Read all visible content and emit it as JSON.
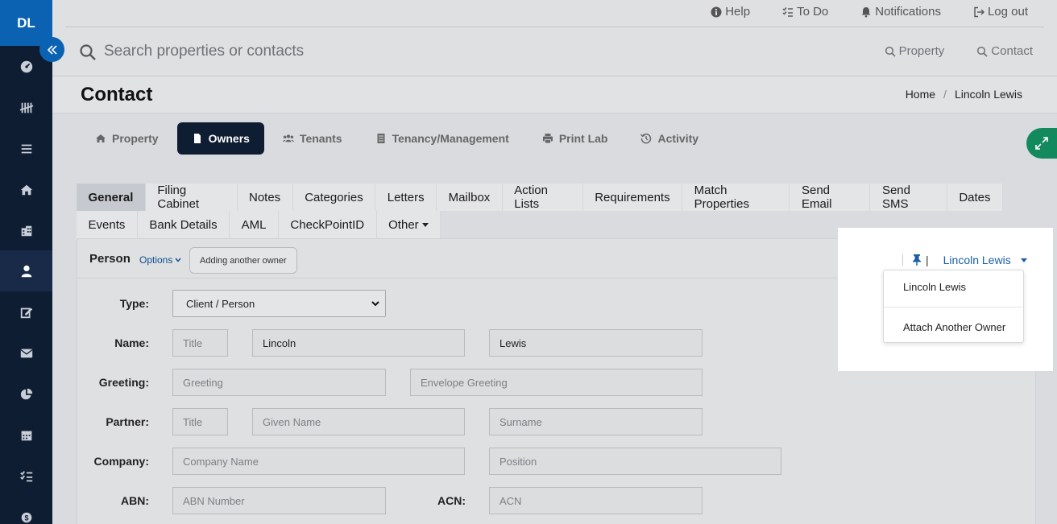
{
  "sidebar": {
    "brand": "DL",
    "items": [
      {
        "icon": "dashboard-icon"
      },
      {
        "icon": "tally-icon"
      },
      {
        "icon": "list-icon"
      },
      {
        "icon": "home-icon"
      },
      {
        "icon": "building-icon"
      },
      {
        "icon": "person-icon",
        "active": true
      },
      {
        "icon": "edit-icon"
      },
      {
        "icon": "mail-icon"
      },
      {
        "icon": "pie-chart-icon"
      },
      {
        "icon": "calendar-icon"
      },
      {
        "icon": "checklist-icon"
      },
      {
        "icon": "money-icon"
      }
    ]
  },
  "header": {
    "links": {
      "help": "Help",
      "todo": "To Do",
      "notifications": "Notifications",
      "logout": "Log out"
    },
    "search": {
      "placeholder": "Search properties or contacts"
    },
    "quick_search": {
      "property": "Property",
      "contact": "Contact"
    }
  },
  "page": {
    "title": "Contact",
    "breadcrumb": {
      "home": "Home",
      "separator": "/",
      "current": "Lincoln Lewis"
    }
  },
  "main_tabs": {
    "property": "Property",
    "owners": "Owners",
    "tenants": "Tenants",
    "tenancy": "Tenancy/Management",
    "print_lab": "Print Lab",
    "activity": "Activity"
  },
  "sub_tabs": {
    "row1": [
      "General",
      "Filing Cabinet",
      "Notes",
      "Categories",
      "Letters",
      "Mailbox",
      "Action Lists",
      "Requirements",
      "Match Properties",
      "Send Email",
      "Send SMS",
      "Dates"
    ],
    "row2": [
      "Events",
      "Bank Details",
      "AML",
      "CheckPointID",
      "Other"
    ]
  },
  "panel": {
    "title": "Person",
    "options": "Options",
    "adding_button": "Adding another owner"
  },
  "form": {
    "type_label": "Type:",
    "type_value": "Client / Person",
    "name_label": "Name:",
    "name_title_placeholder": "Title",
    "name_first": "Lincoln",
    "name_last": "Lewis",
    "greeting_label": "Greeting:",
    "greeting_placeholder": "Greeting",
    "envelope_placeholder": "Envelope Greeting",
    "partner_label": "Partner:",
    "partner_title_placeholder": "Title",
    "partner_given_placeholder": "Given Name",
    "partner_surname_placeholder": "Surname",
    "company_label": "Company:",
    "company_placeholder": "Company Name",
    "position_placeholder": "Position",
    "abn_label": "ABN:",
    "abn_placeholder": "ABN Number",
    "acn_label": "ACN:",
    "acn_placeholder": "ACN"
  },
  "owner_selector": {
    "pipe": "|",
    "current": "Lincoln Lewis",
    "menu": {
      "item1": "Lincoln Lewis",
      "item2": "Attach Another Owner"
    }
  },
  "colors": {
    "sidebar_bg": "#0f1d33",
    "brand_blue": "#0b62b3",
    "active_tab": "#0f1d33",
    "expand_green": "#138a5e",
    "link_blue": "#1a5fa6"
  }
}
